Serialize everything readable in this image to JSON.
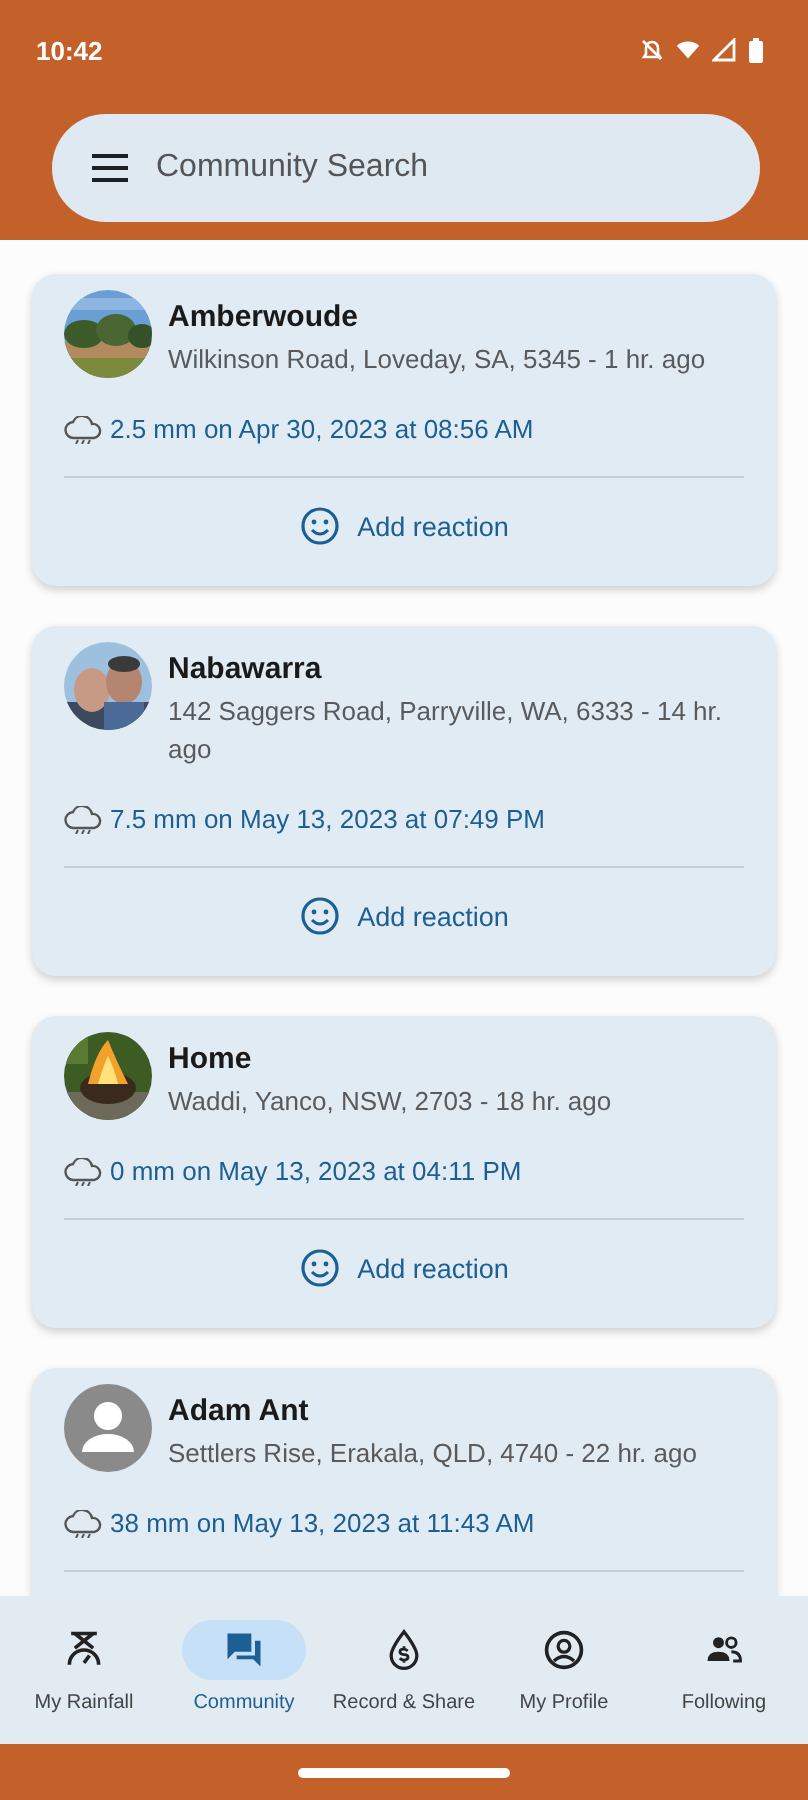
{
  "status_bar": {
    "time": "10:42"
  },
  "search": {
    "placeholder": "Community Search"
  },
  "posts": [
    {
      "name": "Amberwoude",
      "address": "Wilkinson Road, Loveday, SA, 5345 - 1 hr. ago",
      "reading": "2.5 mm on Apr 30, 2023 at 08:56 AM",
      "action": "Add reaction"
    },
    {
      "name": "Nabawarra",
      "address": "142 Saggers Road, Parryville, WA, 6333 - 14 hr. ago",
      "reading": "7.5 mm on May 13, 2023 at 07:49 PM",
      "action": "Add reaction"
    },
    {
      "name": "Home",
      "address": "Waddi, Yanco, NSW, 2703 - 18 hr. ago",
      "reading": "0 mm on May 13, 2023 at 04:11 PM",
      "action": "Add reaction"
    },
    {
      "name": "Adam Ant",
      "address": "Settlers Rise, Erakala, QLD, 4740 - 22 hr. ago",
      "avatar": {
        "kind": "placeholder"
      },
      "reading": "38 mm on May 13, 2023 at 11:43 AM"
    }
  ],
  "nav": [
    {
      "label": "My Rainfall",
      "selected": false
    },
    {
      "label": "Community",
      "selected": true
    },
    {
      "label": "Record & Share",
      "selected": false
    },
    {
      "label": "My Profile",
      "selected": false
    },
    {
      "label": "Following",
      "selected": false
    }
  ]
}
